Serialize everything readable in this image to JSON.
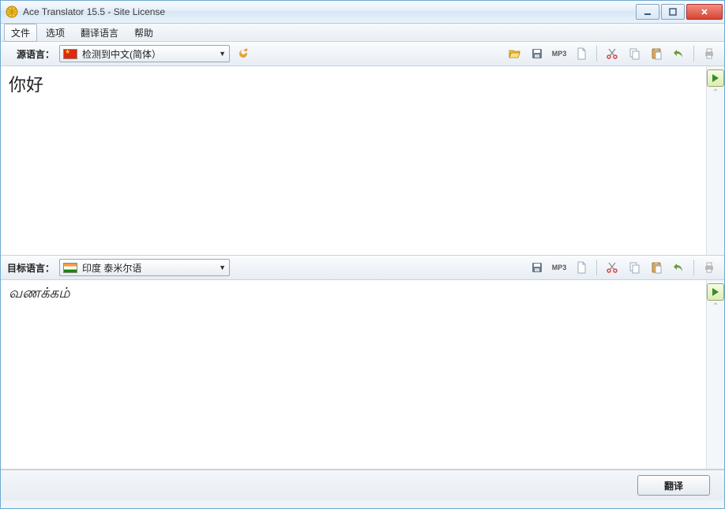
{
  "window": {
    "title": "Ace Translator 15.5 - Site License"
  },
  "menu": {
    "file": "文件",
    "options": "选项",
    "langs": "翻译语言",
    "help": "帮助"
  },
  "source": {
    "label": "源语言：",
    "selected": "检测到中文(简体）",
    "text": "你好",
    "mp3": "MP3"
  },
  "target": {
    "label": "目标语言：",
    "selected": "印度 泰米尔语",
    "text": "வணக்கம்",
    "mp3": "MP3"
  },
  "buttons": {
    "translate": "翻译"
  }
}
